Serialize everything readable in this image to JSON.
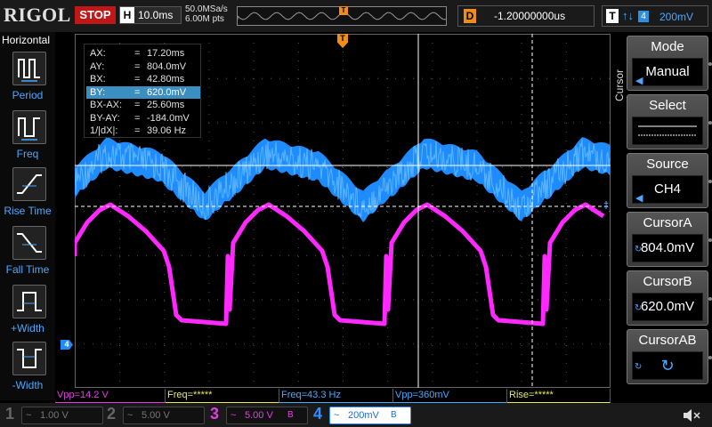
{
  "header": {
    "logo": "RIGOL",
    "run_state": "STOP",
    "timebase_letter": "H",
    "timebase": "10.0ms",
    "sample_rate": "50.0MSa/s",
    "memory_depth": "6.00M pts",
    "trigger_pos_marker": "T",
    "delay_letter": "D",
    "delay": "-1.20000000us",
    "trigger_letter": "T",
    "trigger_slope": "↑↓",
    "trigger_channel": "4",
    "trigger_level": "200mV"
  },
  "left_panel": {
    "title": "Horizontal",
    "measurements": [
      {
        "label": "Period",
        "icon": "period-icon"
      },
      {
        "label": "Freq",
        "icon": "freq-icon"
      },
      {
        "label": "Rise Time",
        "icon": "rise-time-icon"
      },
      {
        "label": "Fall Time",
        "icon": "fall-time-icon"
      },
      {
        "label": "+Width",
        "icon": "pos-width-icon"
      },
      {
        "label": "-Width",
        "icon": "neg-width-icon"
      }
    ]
  },
  "cursor_readout": {
    "rows": [
      {
        "key": "AX:",
        "eq": "=",
        "value": "17.20ms"
      },
      {
        "key": "AY:",
        "eq": "=",
        "value": "804.0mV"
      },
      {
        "key": "BX:",
        "eq": "=",
        "value": "42.80ms"
      },
      {
        "key": "BY:",
        "eq": "=",
        "value": "620.0mV"
      },
      {
        "key": "BX-AX:",
        "eq": "=",
        "value": "25.60ms"
      },
      {
        "key": "BY-AY:",
        "eq": "=",
        "value": "-184.0mV"
      },
      {
        "key": "1/|dX|:",
        "eq": "=",
        "value": "39.06 Hz"
      }
    ],
    "selected_row": 3
  },
  "markers": {
    "trigger_top": "T",
    "ch4_left": "4",
    "ch4_cursor_right": "‡"
  },
  "measurement_bar": [
    {
      "text": "Vpp=14.2 V",
      "color": "#e040e0"
    },
    {
      "text": "Freq=*****",
      "color": "#e8e860"
    },
    {
      "text": "Freq=43.3 Hz",
      "color": "#4aa8ff"
    },
    {
      "text": "Vpp=360mV",
      "color": "#4aa8ff"
    },
    {
      "text": "Rise=*****",
      "color": "#e8e860"
    }
  ],
  "channels": [
    {
      "num": "1",
      "wave": "~",
      "volts": "1.00 V",
      "flag": "",
      "color": "#e8e840",
      "active": false
    },
    {
      "num": "2",
      "wave": "~",
      "volts": "5.00 V",
      "flag": "",
      "color": "#40e0e0",
      "active": false
    },
    {
      "num": "3",
      "wave": "~",
      "volts": "5.00 V",
      "flag": "B",
      "color": "#e040e0",
      "active": true
    },
    {
      "num": "4",
      "wave": "~",
      "volts": "200mV",
      "flag": "B",
      "color": "#3090ff",
      "active": true
    }
  ],
  "right_menu": {
    "section_label": "Cursor",
    "buttons": [
      {
        "title": "Mode",
        "value": "Manual",
        "has_arrow": true,
        "has_knob": false
      },
      {
        "title": "Select",
        "value": "",
        "has_arrow": false,
        "has_knob": false
      },
      {
        "title": "Source",
        "value": "CH4",
        "has_arrow": true,
        "has_knob": false
      },
      {
        "title": "CursorA",
        "value": "804.0mV",
        "has_arrow": false,
        "has_knob": true
      },
      {
        "title": "CursorB",
        "value": "620.0mV",
        "has_arrow": false,
        "has_knob": true
      },
      {
        "title": "CursorAB",
        "value": "",
        "has_arrow": false,
        "has_knob": true
      }
    ]
  },
  "colors": {
    "ch3": "#ff28ff",
    "ch4": "#1e8cff",
    "accent_blue": "#4aa8ff",
    "trigger_orange": "#f08c1c",
    "stop_red": "#c01818"
  }
}
